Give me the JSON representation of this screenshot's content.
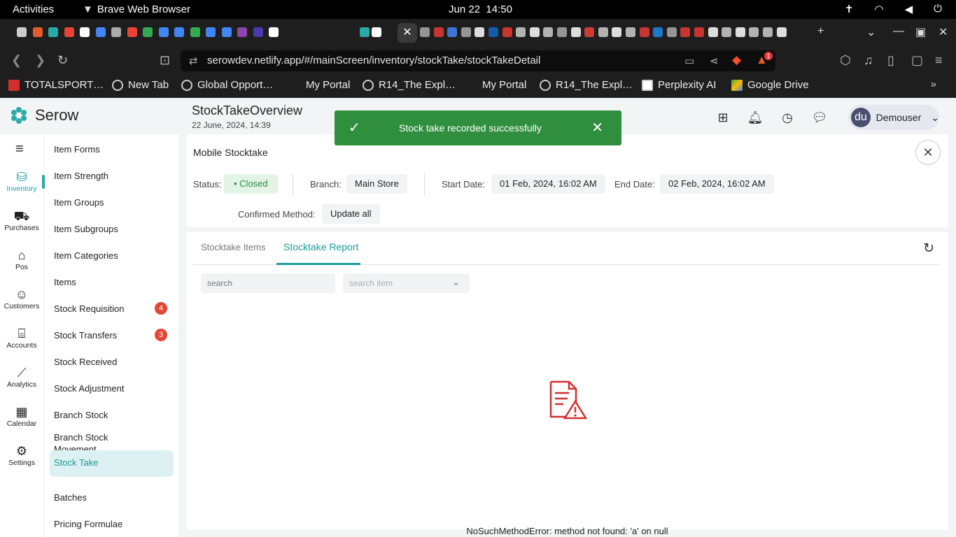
{
  "os": {
    "activities": "Activities",
    "app_name": "Brave Web Browser",
    "date": "Jun 22",
    "time": "14:50"
  },
  "browser": {
    "url": "serowdev.netlify.app/#/mainScreen/inventory/stockTake/stockTakeDetail",
    "bookmarks": [
      "TOTALSPORT…",
      "New Tab",
      "Global Opport…",
      "My Portal",
      "R14_The Expl…",
      "My Portal",
      "R14_The Expl…",
      "Perplexity AI",
      "Google Drive"
    ],
    "new_tab_symbol": "+",
    "notification_count": "1"
  },
  "app": {
    "brand": "Serow",
    "page_title": "StockTakeOverview",
    "page_date": "22 June, 2024, 14:39",
    "user_initials": "du",
    "user_name": "Demouser"
  },
  "toast": {
    "message": "Stock take recorded successfully"
  },
  "rail": [
    {
      "label": "Inventory",
      "icon": "database-icon"
    },
    {
      "label": "Purchases",
      "icon": "cart-icon"
    },
    {
      "label": "Pos",
      "icon": "store-icon"
    },
    {
      "label": "Customers",
      "icon": "users-icon"
    },
    {
      "label": "Accounts",
      "icon": "bank-icon"
    },
    {
      "label": "Analytics",
      "icon": "analytics-icon"
    },
    {
      "label": "Calendar",
      "icon": "calendar-icon"
    },
    {
      "label": "Settings",
      "icon": "gear-icon"
    }
  ],
  "submenu": [
    {
      "label": "Item Forms"
    },
    {
      "label": "Item Strength"
    },
    {
      "label": "Item Groups"
    },
    {
      "label": "Item Subgroups"
    },
    {
      "label": "Item Categories"
    },
    {
      "label": "Items"
    },
    {
      "label": "Stock Requisition",
      "badge": "4"
    },
    {
      "label": "Stock Transfers",
      "badge": "3"
    },
    {
      "label": "Stock Received"
    },
    {
      "label": "Stock Adjustment"
    },
    {
      "label": "Branch Stock"
    },
    {
      "label": "Branch Stock Movement"
    },
    {
      "label": "Stock Take",
      "active": true
    },
    {
      "label": "Batches"
    },
    {
      "label": "Pricing Formulae"
    }
  ],
  "detail": {
    "title": "Mobile Stocktake",
    "status_label": "Status:",
    "status_value": "Closed",
    "branch_label": "Branch:",
    "branch_value": "Main Store",
    "start_label": "Start Date:",
    "start_value": "01 Feb, 2024, 16:02 AM",
    "end_label": "End Date:",
    "end_value": "02 Feb, 2024, 16:02 AM",
    "method_label": "Confirmed Method:",
    "method_value": "Update all"
  },
  "tabs": [
    {
      "label": "Stocktake Items"
    },
    {
      "label": "Stocktake Report",
      "active": true
    }
  ],
  "filters": {
    "search_placeholder": "search",
    "item_placeholder": "search item"
  },
  "error": {
    "message": "NoSuchMethodError: method not found: 'a' on null"
  },
  "colors": {
    "accent": "#1a9c9c",
    "success": "#2f8f3f",
    "badge": "#e44535",
    "error_icon": "#d32f2f"
  }
}
